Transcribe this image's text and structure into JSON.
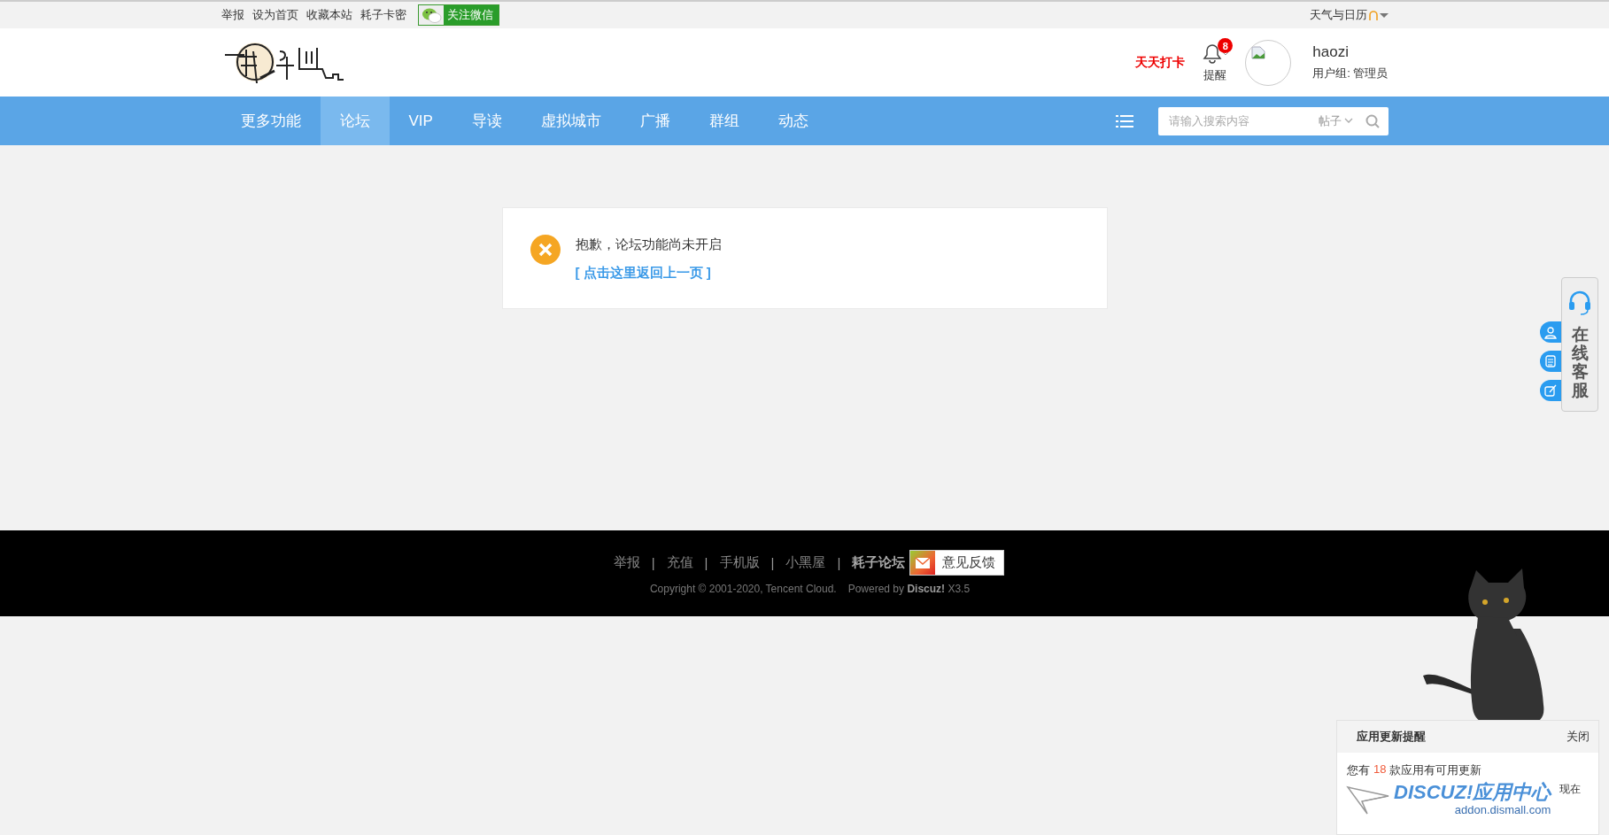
{
  "top_bar": {
    "links": [
      "举报",
      "设为首页",
      "收藏本站",
      "耗子卡密"
    ],
    "wechat_button": "关注微信",
    "weather": "天气与日历"
  },
  "header": {
    "checkin": "天天打卡",
    "notifications": {
      "label": "提醒",
      "count": "8"
    },
    "user": {
      "name": "haozi",
      "group": "用户组: 管理员"
    }
  },
  "nav": {
    "items": [
      {
        "label": "更多功能",
        "selected": false
      },
      {
        "label": "论坛",
        "selected": true
      },
      {
        "label": "VIP",
        "selected": false
      },
      {
        "label": "导读",
        "selected": false
      },
      {
        "label": "虚拟城市",
        "selected": false
      },
      {
        "label": "广播",
        "selected": false
      },
      {
        "label": "群组",
        "selected": false
      },
      {
        "label": "动态",
        "selected": false
      }
    ],
    "search": {
      "placeholder": "请输入搜索内容",
      "scope": "帖子"
    }
  },
  "message": {
    "text": "抱歉，论坛功能尚未开启",
    "link": "[ 点击这里返回上一页 ]"
  },
  "footer": {
    "links": [
      {
        "label": "举报",
        "kind": "link"
      },
      {
        "label": "|",
        "kind": "separator"
      },
      {
        "label": "充值",
        "kind": "link"
      },
      {
        "label": "|",
        "kind": "separator"
      },
      {
        "label": "手机版",
        "kind": "link"
      },
      {
        "label": "|",
        "kind": "separator"
      },
      {
        "label": "小黑屋",
        "kind": "link"
      },
      {
        "label": "|",
        "kind": "separator"
      },
      {
        "label": "耗子论坛",
        "kind": "strong"
      }
    ],
    "feedback_button": "意见反馈",
    "copyright": "Copyright © 2001-2020, Tencent Cloud.",
    "powered_by": "Powered by **Discuz!** X3.5"
  },
  "side_service": {
    "label": "在线客服"
  },
  "update_popup": {
    "title": "应用更新提醒",
    "close": "关闭",
    "message_prefix": "您有",
    "count": "18",
    "message_suffix": "款应用有可用更新",
    "banner_title": "DISCUZ!应用中心",
    "banner_url": "addon.dismall.com",
    "action": "现在"
  }
}
